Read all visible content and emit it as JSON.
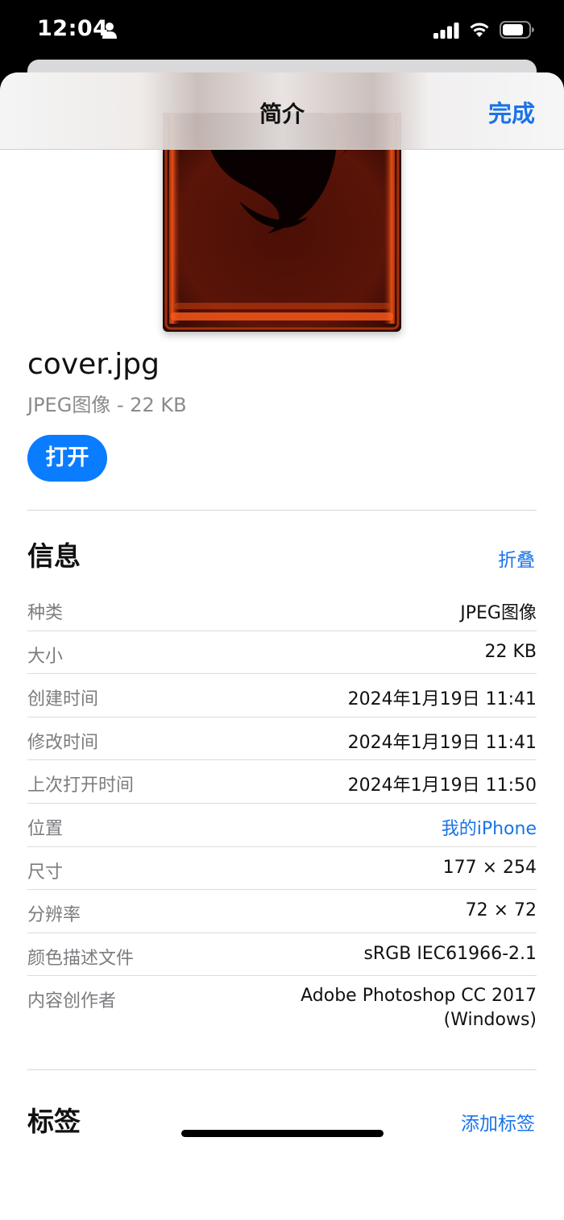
{
  "status_bar": {
    "time": "12:04",
    "icons": [
      "person-icon",
      "signal-icon",
      "wifi-icon",
      "battery-icon"
    ]
  },
  "nav": {
    "title": "简介",
    "done_label": "完成"
  },
  "file": {
    "name": "cover.jpg",
    "subtitle": "JPEG图像 - 22 KB",
    "open_label": "打开"
  },
  "info": {
    "title": "信息",
    "collapse_label": "折叠",
    "rows": [
      {
        "label": "种类",
        "value": "JPEG图像"
      },
      {
        "label": "大小",
        "value": "22 KB"
      },
      {
        "label": "创建时间",
        "value": "2024年1月19日 11:41"
      },
      {
        "label": "修改时间",
        "value": "2024年1月19日 11:41"
      },
      {
        "label": "上次打开时间",
        "value": "2024年1月19日 11:50"
      },
      {
        "label": "位置",
        "value": "我的iPhone"
      },
      {
        "label": "尺寸",
        "value": "177 × 254"
      },
      {
        "label": "分辨率",
        "value": "72 × 72"
      },
      {
        "label": "颜色描述文件",
        "value": "sRGB IEC61966-2.1"
      },
      {
        "label": "内容创作者",
        "value_line1": "Adobe Photoshop CC 2017",
        "value_line2": "(Windows)"
      }
    ]
  },
  "tags": {
    "title": "标签",
    "add_label": "添加标签"
  },
  "colors": {
    "accent": "#1a73e8",
    "button_bg": "#0a7cff"
  }
}
